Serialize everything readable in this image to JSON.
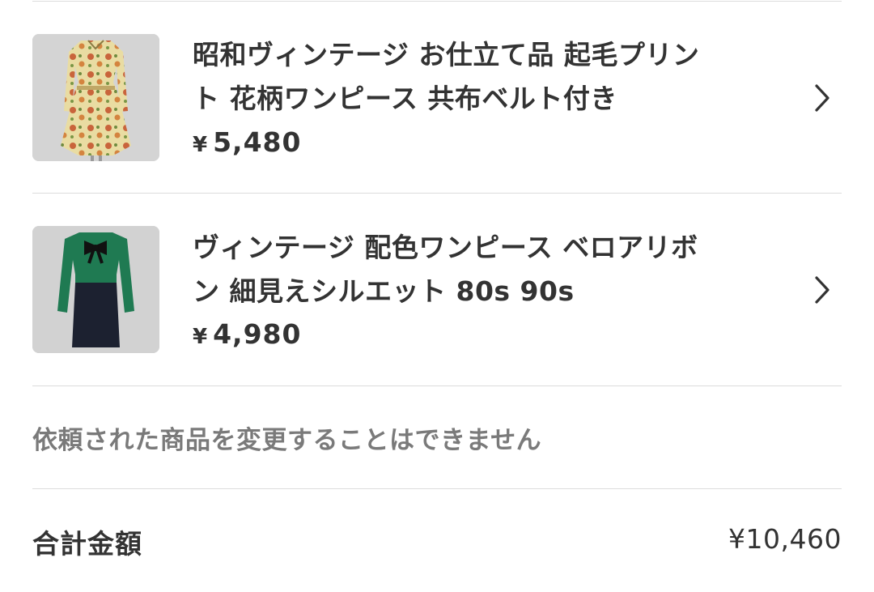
{
  "items": [
    {
      "title_line1": "昭和ヴィンテージ お仕立て品 起毛プリン",
      "title_line2": "ト 花柄ワンピース 共布ベルト付き",
      "currency": "¥",
      "price": "5,480",
      "image_icon": "floral-dress-photo"
    },
    {
      "title_line1": "ヴィンテージ 配色ワンピース ベロアリボ",
      "title_line2": "ン 細見えシルエット 80s 90s",
      "currency": "¥",
      "price": "4,980",
      "image_icon": "green-navy-dress-photo"
    }
  ],
  "notice": "依頼された商品を変更することはできません",
  "total": {
    "label": "合計金額",
    "value": "¥10,460"
  },
  "colors": {
    "text": "#333333",
    "muted": "#7a7a7a",
    "divider": "#dcdcdc"
  }
}
